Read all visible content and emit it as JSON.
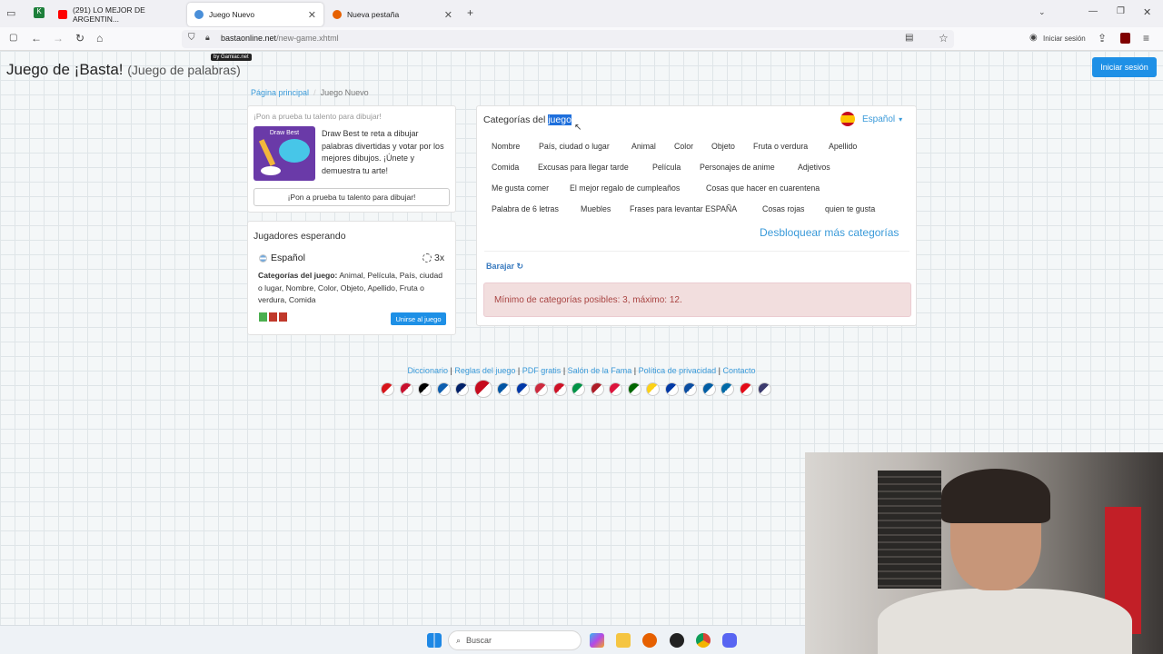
{
  "browser": {
    "tabs": [
      {
        "label": "(291) LO MEJOR DE ARGENTIN..."
      },
      {
        "label": "Juego Nuevo"
      },
      {
        "label": "Nueva pestaña"
      }
    ],
    "url_domain": "bastaonline.net",
    "url_path": "/new-game.xhtml",
    "signin_label": "Iniciar sesión"
  },
  "header": {
    "title": "Juego de ¡Basta!",
    "subtitle": "(Juego de palabras)",
    "badge": "by Gamiac.net",
    "login_button": "Iniciar sesión"
  },
  "breadcrumb": {
    "home": "Página principal",
    "sep": "/",
    "current": "Juego Nuevo"
  },
  "promo": {
    "heading": "¡Pon a prueba tu talento para dibujar!",
    "image_title": "Draw Best",
    "text": "Draw Best te reta a dibujar palabras divertidas y votar por los mejores dibujos. ¡Únete y demuestra tu arte!",
    "button": "¡Pon a prueba tu talento para dibujar!"
  },
  "waiting": {
    "title": "Jugadores esperando",
    "language": "Español",
    "rounds": "3x",
    "categories_label": "Categorías del juego:",
    "categories_value": "Animal, Película, País, ciudad o lugar, Nombre, Color, Objeto, Apellido, Fruta o verdura, Comida",
    "join_button": "Unirse al juego",
    "avatar_colors": [
      "#4caf50",
      "#c0392b",
      "#c0392b"
    ]
  },
  "categories": {
    "title_prefix": "Categorías del",
    "title_highlight": "juego",
    "language": "Español",
    "items": [
      "Nombre",
      "País, ciudad o lugar",
      "Animal",
      "Color",
      "Objeto",
      "Fruta o verdura",
      "Apellido",
      "Comida",
      "Excusas para llegar tarde",
      "Película",
      "Personajes de anime",
      "Adjetivos",
      "Me gusta comer",
      "El mejor regalo de cumpleaños",
      "Cosas que hacer en cuarentena",
      "Palabra de 6 letras",
      "Muebles",
      "Frases para levantar ESPAÑA",
      "Cosas rojas",
      "quien te gusta"
    ],
    "unlock_link": "Desbloquear más categorías",
    "shuffle": "Barajar",
    "alert": "Mínimo de categorías posibles: 3, máximo: 12."
  },
  "footer": {
    "links": [
      "Diccionario",
      "Reglas del juego",
      "PDF gratis",
      "Salón de la Fama",
      "Política de privacidad",
      "Contacto"
    ],
    "flag_colors": [
      "#d7141a",
      "#c8102e",
      "#000000",
      "#0d5eaf",
      "#012169",
      "#c60b1e",
      "#0055a4",
      "#0038a8",
      "#cd2a3e",
      "#ce1126",
      "#009246",
      "#ae1c28",
      "#dc143c",
      "#006600",
      "#fcd116",
      "#0039a6",
      "#0b4ea2",
      "#005da4",
      "#006aa7",
      "#e30a17",
      "#3c3b6e"
    ]
  },
  "taskbar": {
    "search_placeholder": "Buscar"
  }
}
